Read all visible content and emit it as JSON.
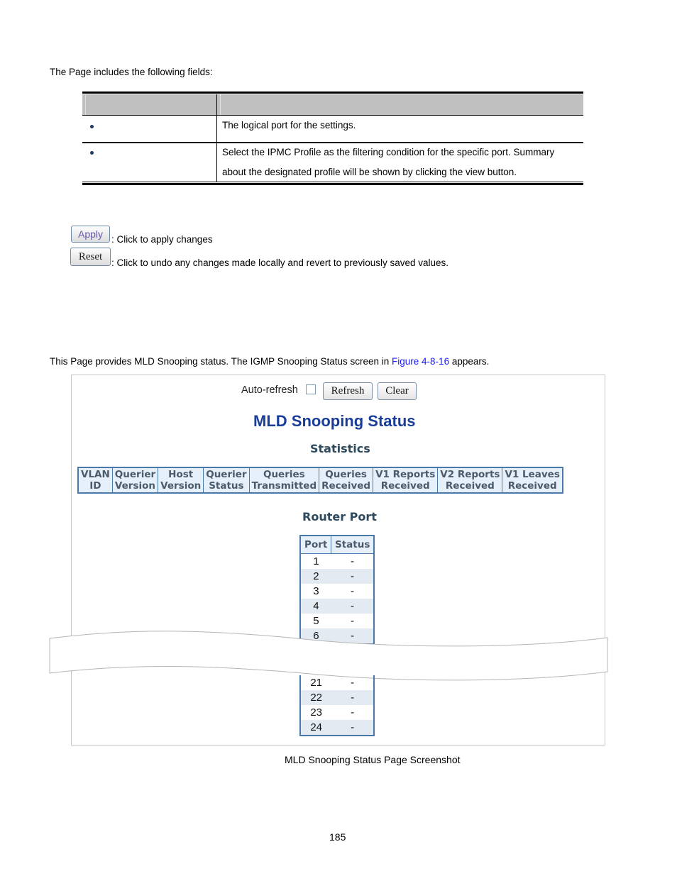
{
  "intro_text": "The Page includes the following fields:",
  "fields_table": {
    "header": [
      "",
      ""
    ],
    "rows": [
      {
        "object": "",
        "description": [
          "The logical port for the settings."
        ]
      },
      {
        "object": "",
        "description": [
          "Select the IPMC Profile as the filtering condition for the specific port. Summary",
          "about the designated profile will be shown by clicking the view button."
        ]
      }
    ]
  },
  "buttons_help": [
    {
      "label": "Apply",
      "description": ": Click to apply changes"
    },
    {
      "label": "Reset",
      "description": ": Click to undo any changes made locally and revert to previously saved values."
    }
  ],
  "section_intro": {
    "before_link": "This Page provides MLD Snooping status. The IGMP Snooping Status screen in ",
    "link": "Figure 4-8-16",
    "after_link": " appears."
  },
  "screenshot": {
    "auto_refresh_label": "Auto-refresh",
    "auto_refresh_checked": false,
    "refresh_label": "Refresh",
    "clear_label": "Clear",
    "title": "MLD Snooping Status",
    "statistics_title": "Statistics",
    "statistics_columns": [
      [
        "VLAN",
        "ID"
      ],
      [
        "Querier",
        "Version"
      ],
      [
        "Host",
        "Version"
      ],
      [
        "Querier",
        "Status"
      ],
      [
        "Queries",
        "Transmitted"
      ],
      [
        "Queries",
        "Received"
      ],
      [
        "V1 Reports",
        "Received"
      ],
      [
        "V2 Reports",
        "Received"
      ],
      [
        "V1 Leaves",
        "Received"
      ]
    ],
    "router_port_title": "Router Port",
    "router_port_columns": [
      "Port",
      "Status"
    ],
    "router_ports_top": [
      {
        "port": "1",
        "status": "-"
      },
      {
        "port": "2",
        "status": "-"
      },
      {
        "port": "3",
        "status": "-"
      },
      {
        "port": "4",
        "status": "-"
      },
      {
        "port": "5",
        "status": "-"
      },
      {
        "port": "6",
        "status": "-"
      }
    ],
    "router_ports_bottom": [
      {
        "port": "21",
        "status": "-"
      },
      {
        "port": "22",
        "status": "-"
      },
      {
        "port": "23",
        "status": "-"
      },
      {
        "port": "24",
        "status": "-"
      }
    ]
  },
  "caption": "MLD Snooping Status Page Screenshot",
  "page_number": "185",
  "colors": {
    "link": "#1a1aff",
    "title": "#1a3d9a",
    "table_border": "#4a78a8",
    "table_header_bg": "#e6f0fb",
    "row_alt_bg": "#e3eaf2"
  }
}
